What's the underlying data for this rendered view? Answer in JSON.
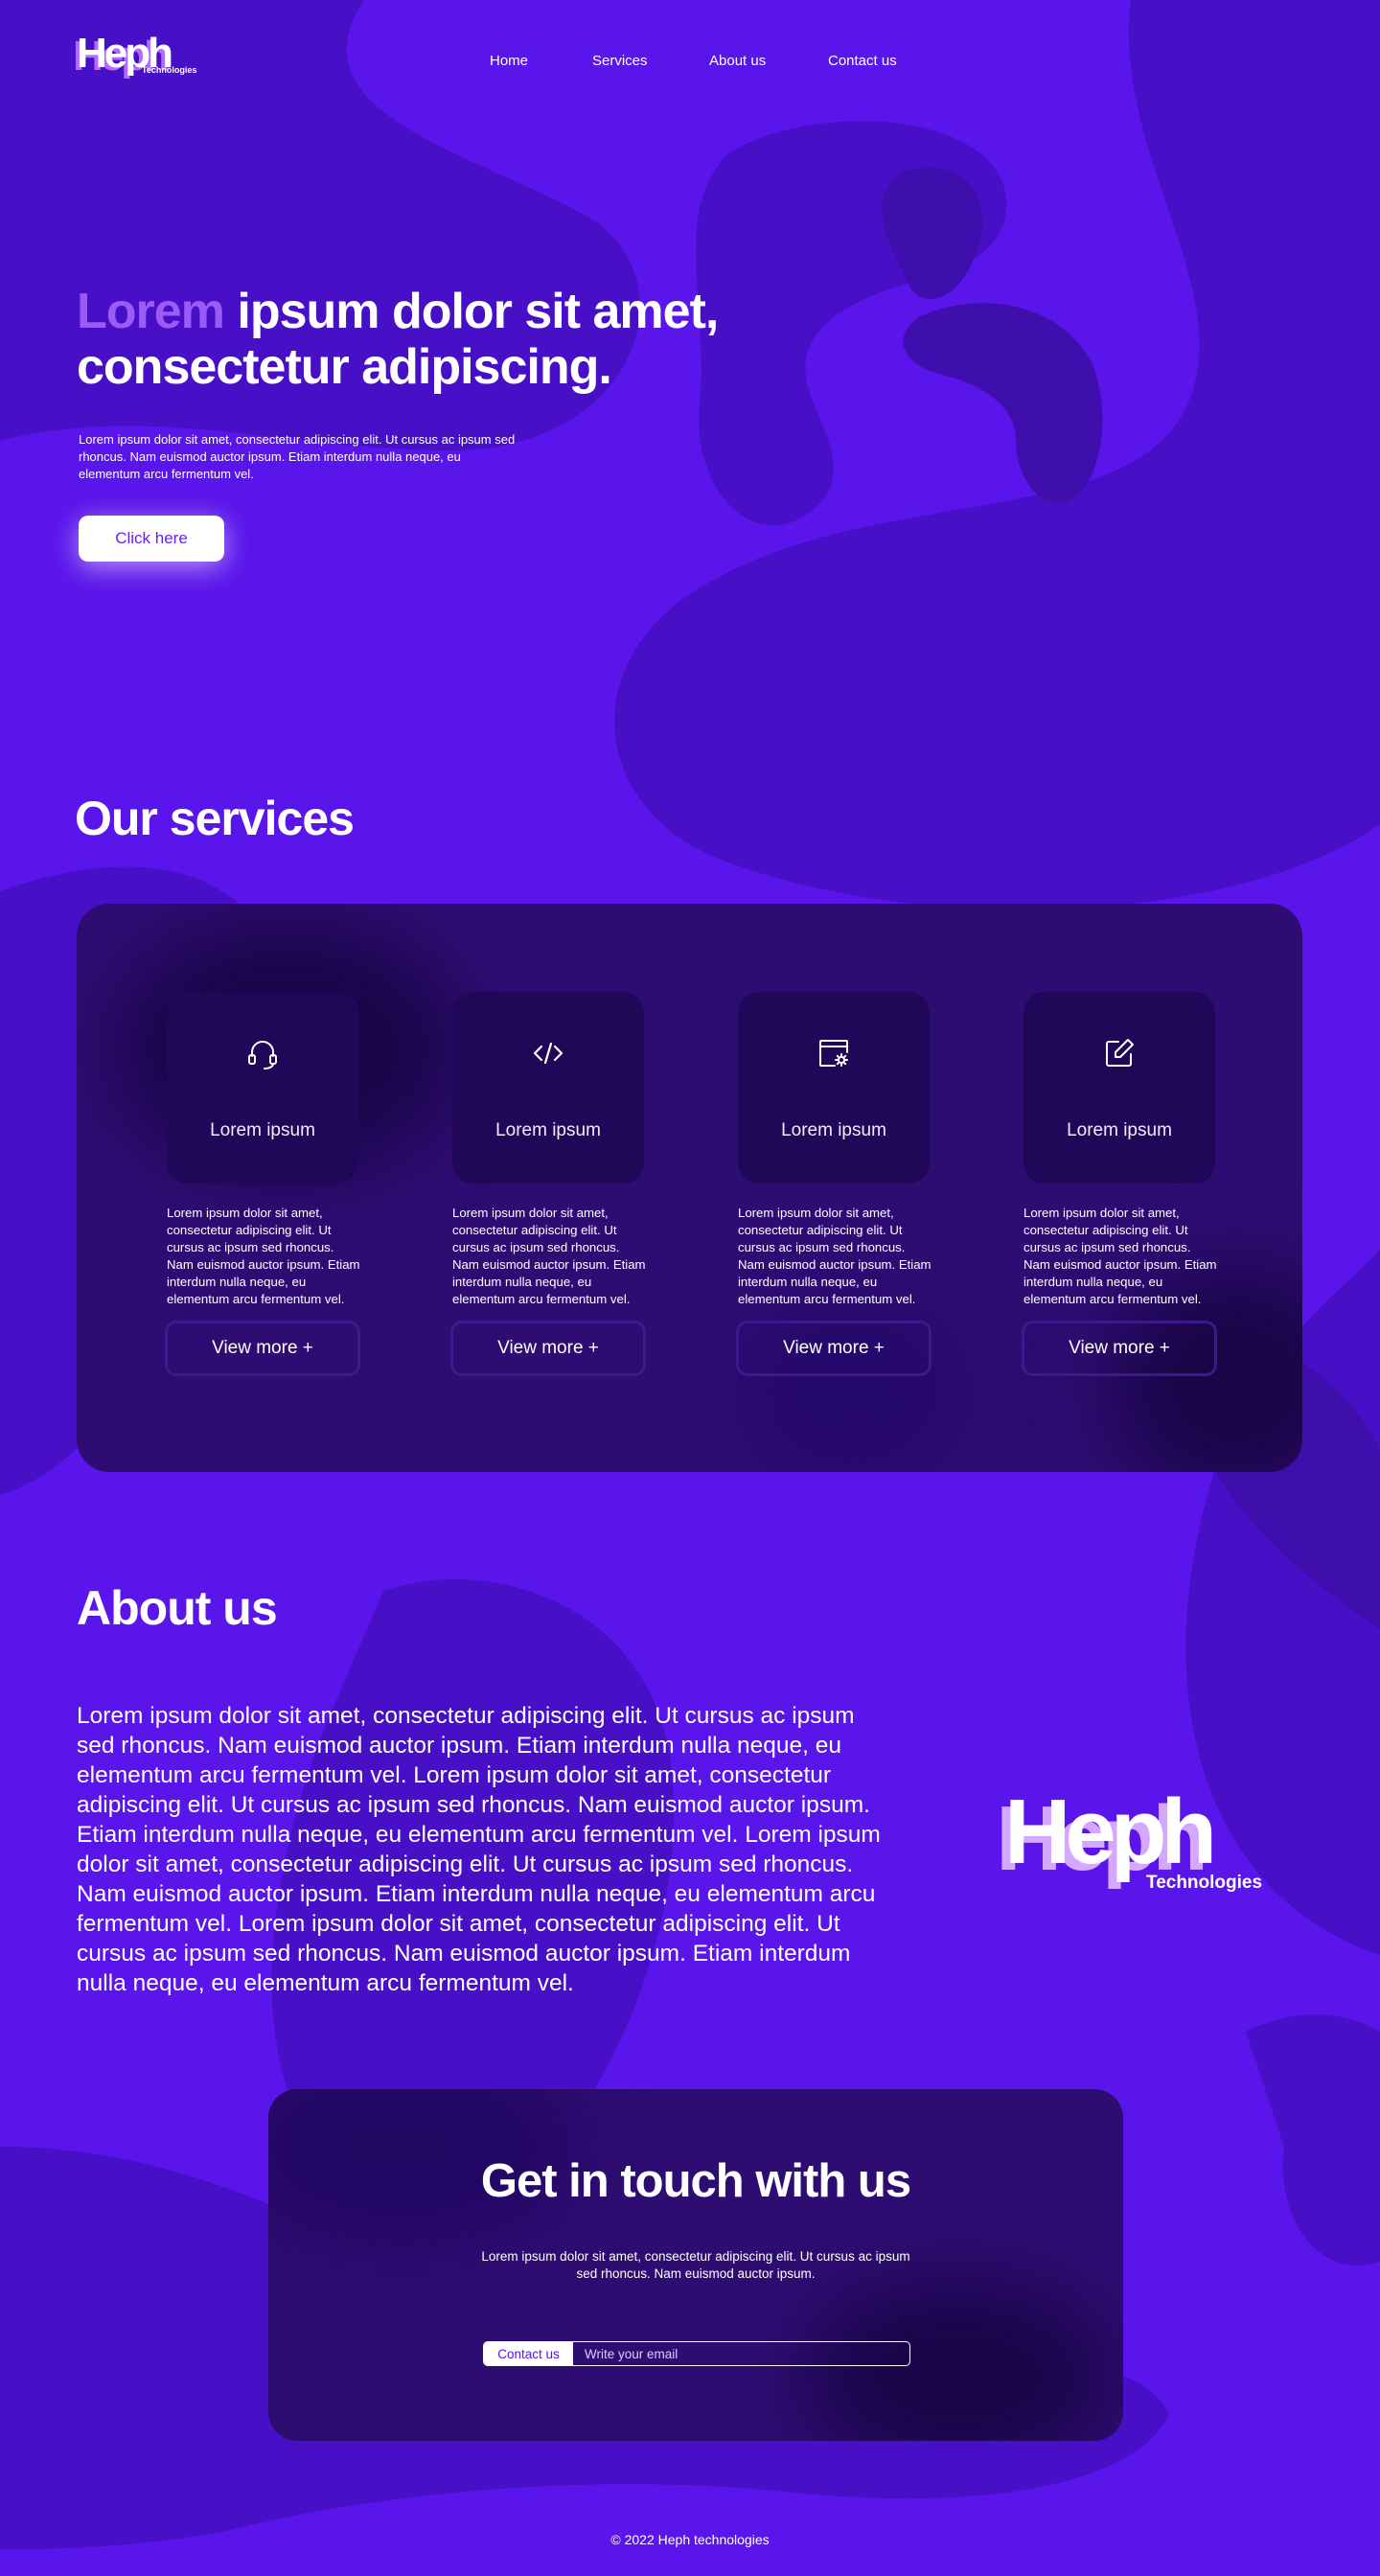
{
  "brand": {
    "name": "Heph",
    "tagline": "Technologies"
  },
  "nav": {
    "items": [
      "Home",
      "Services",
      "About us",
      "Contact us"
    ]
  },
  "hero": {
    "title_accent": "Lorem",
    "title_rest": " ipsum dolor sit amet, consectetur adipiscing.",
    "text": "Lorem ipsum dolor sit amet, consectetur adipiscing elit. Ut cursus ac ipsum sed rhoncus. Nam euismod auctor ipsum. Etiam interdum nulla neque, eu elementum arcu fermentum vel.",
    "button_label": "Click here"
  },
  "services": {
    "title": "Our services",
    "items": [
      {
        "icon": "headset-icon",
        "name": "Lorem ipsum",
        "description": "Lorem ipsum dolor sit amet, consectetur adipiscing elit. Ut cursus ac ipsum sed rhoncus. Nam euismod auctor ipsum. Etiam interdum nulla neque, eu elementum arcu fermentum vel.",
        "button_label": "View more +"
      },
      {
        "icon": "code-icon",
        "name": "Lorem ipsum",
        "description": "Lorem ipsum dolor sit amet, consectetur adipiscing elit. Ut cursus ac ipsum sed rhoncus. Nam euismod auctor ipsum. Etiam interdum nulla neque, eu elementum arcu fermentum vel.",
        "button_label": "View more +"
      },
      {
        "icon": "browser-settings-icon",
        "name": "Lorem ipsum",
        "description": "Lorem ipsum dolor sit amet, consectetur adipiscing elit. Ut cursus ac ipsum sed rhoncus. Nam euismod auctor ipsum. Etiam interdum nulla neque, eu elementum arcu fermentum vel.",
        "button_label": "View more +"
      },
      {
        "icon": "edit-icon",
        "name": "Lorem ipsum",
        "description": "Lorem ipsum dolor sit amet, consectetur adipiscing elit. Ut cursus ac ipsum sed rhoncus. Nam euismod auctor ipsum. Etiam interdum nulla neque, eu elementum arcu fermentum vel.",
        "button_label": "View more +"
      }
    ]
  },
  "about": {
    "title": "About us",
    "text": "Lorem ipsum dolor sit amet, consectetur adipiscing elit. Ut cursus ac ipsum sed rhoncus. Nam euismod auctor ipsum. Etiam interdum nulla neque, eu elementum arcu fermentum vel. Lorem ipsum dolor sit amet, consectetur adipiscing elit. Ut cursus ac ipsum sed rhoncus. Nam euismod auctor ipsum. Etiam interdum nulla neque, eu elementum arcu fermentum vel. Lorem ipsum dolor sit amet, consectetur adipiscing elit. Ut cursus ac ipsum sed rhoncus. Nam euismod auctor ipsum. Etiam interdum nulla neque, eu elementum arcu fermentum vel. Lorem ipsum dolor sit amet, consectetur adipiscing elit. Ut cursus ac ipsum sed rhoncus. Nam euismod auctor ipsum. Etiam interdum nulla neque, eu elementum arcu fermentum vel."
  },
  "contact": {
    "title": "Get in touch with us",
    "text": "Lorem ipsum dolor sit amet, consectetur adipiscing elit. Ut cursus ac ipsum sed rhoncus. Nam euismod auctor ipsum.",
    "button_label": "Contact us",
    "input_placeholder": "Write your email"
  },
  "footer": {
    "copyright": "© 2022 Heph technologies"
  },
  "colors": {
    "background": "#5a15ea",
    "blob": "#4810c6",
    "blob_dark": "#3f0fae",
    "panel": "#2e0d72",
    "card": "#200859",
    "accent": "#9b5cf6"
  }
}
